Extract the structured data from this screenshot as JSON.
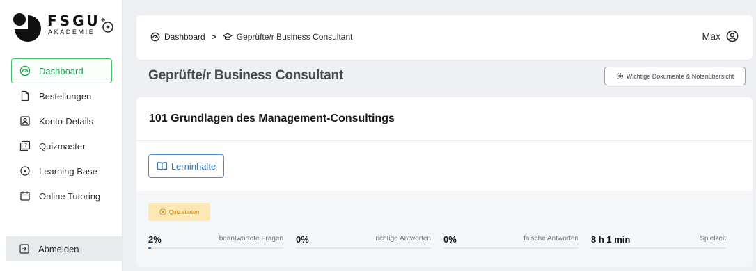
{
  "brand": {
    "name": "FSGU",
    "registered": "®",
    "subtitle": "AKADEMIE"
  },
  "sidebar": {
    "items": [
      {
        "label": "Dashboard",
        "icon": "dashboard-gauge-icon",
        "active": true
      },
      {
        "label": "Bestellungen",
        "icon": "document-icon",
        "active": false
      },
      {
        "label": "Konto-Details",
        "icon": "user-card-icon",
        "active": false
      },
      {
        "label": "Quizmaster",
        "icon": "quiz-icon",
        "active": false
      },
      {
        "label": "Learning Base",
        "icon": "target-icon",
        "active": false
      },
      {
        "label": "Online Tutoring",
        "icon": "calendar-icon",
        "active": false
      }
    ],
    "logout_label": "Abmelden"
  },
  "header": {
    "breadcrumb": {
      "home": "Dashboard",
      "separator": ">",
      "current": "Geprüfte/r Business Consultant"
    },
    "user_name": "Max"
  },
  "page": {
    "title": "Geprüfte/r Business Consultant",
    "docs_button": "Wichtige Dokumente & Notenübersicht"
  },
  "course": {
    "title": "101 Grundlagen des Management-Consultings",
    "lern_button": "Lerninhalte",
    "quiz_button": "Quiz starten",
    "stats": [
      {
        "value": "2%",
        "label": "beantwortete Fragen",
        "progress_fraction": 0.02
      },
      {
        "value": "0%",
        "label": "richtige Antworten",
        "progress_fraction": 0
      },
      {
        "value": "0%",
        "label": "falsche Antworten",
        "progress_fraction": 0
      },
      {
        "value": "8 h 1 min",
        "label": "Spielzeit",
        "progress_fraction": 0
      }
    ]
  },
  "colors": {
    "accent_green": "#23a455",
    "accent_blue": "#2f79c7",
    "quiz_yellow_bg": "#fde7b5",
    "quiz_yellow_text": "#c98a06"
  }
}
